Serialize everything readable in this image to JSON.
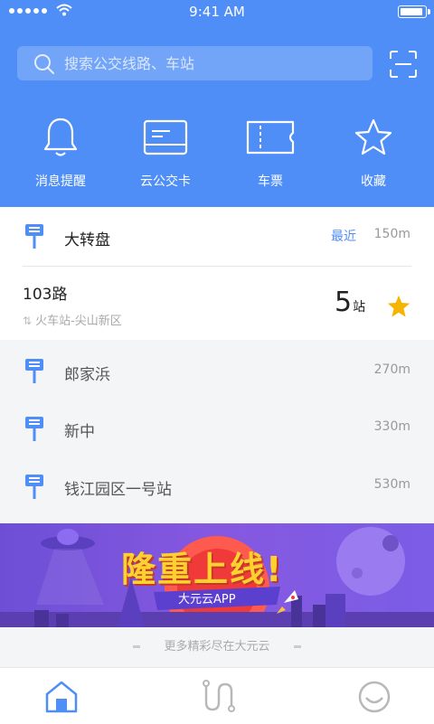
{
  "status_bar": {
    "time": "9:41 AM"
  },
  "search": {
    "placeholder": "搜索公交线路、车站"
  },
  "quick_actions": [
    {
      "label": "消息提醒",
      "icon": "bell-icon"
    },
    {
      "label": "云公交卡",
      "icon": "card-icon"
    },
    {
      "label": "车票",
      "icon": "ticket-icon"
    },
    {
      "label": "收藏",
      "icon": "star-outline-icon"
    }
  ],
  "nearby": {
    "name": "大转盘",
    "tag": "最近",
    "distance": "150m",
    "route": {
      "name": "103路",
      "direction": "火车站-尖山新区",
      "stations_count": "5",
      "stations_unit": "站"
    }
  },
  "stops": [
    {
      "name": "郎家浜",
      "distance": "270m"
    },
    {
      "name": "新中",
      "distance": "330m"
    },
    {
      "name": "钱江园区一号站",
      "distance": "530m"
    }
  ],
  "banner": {
    "headline": "隆重上线!",
    "app_name": "大元云APP"
  },
  "more_text": "更多精彩尽在大元云",
  "tabs": [
    {
      "icon": "home-icon",
      "active": true
    },
    {
      "icon": "route-icon",
      "active": false
    },
    {
      "icon": "profile-icon",
      "active": false
    }
  ],
  "colors": {
    "primary": "#4f8ef7",
    "star": "#f5b400",
    "banner": "#7b5de6"
  }
}
